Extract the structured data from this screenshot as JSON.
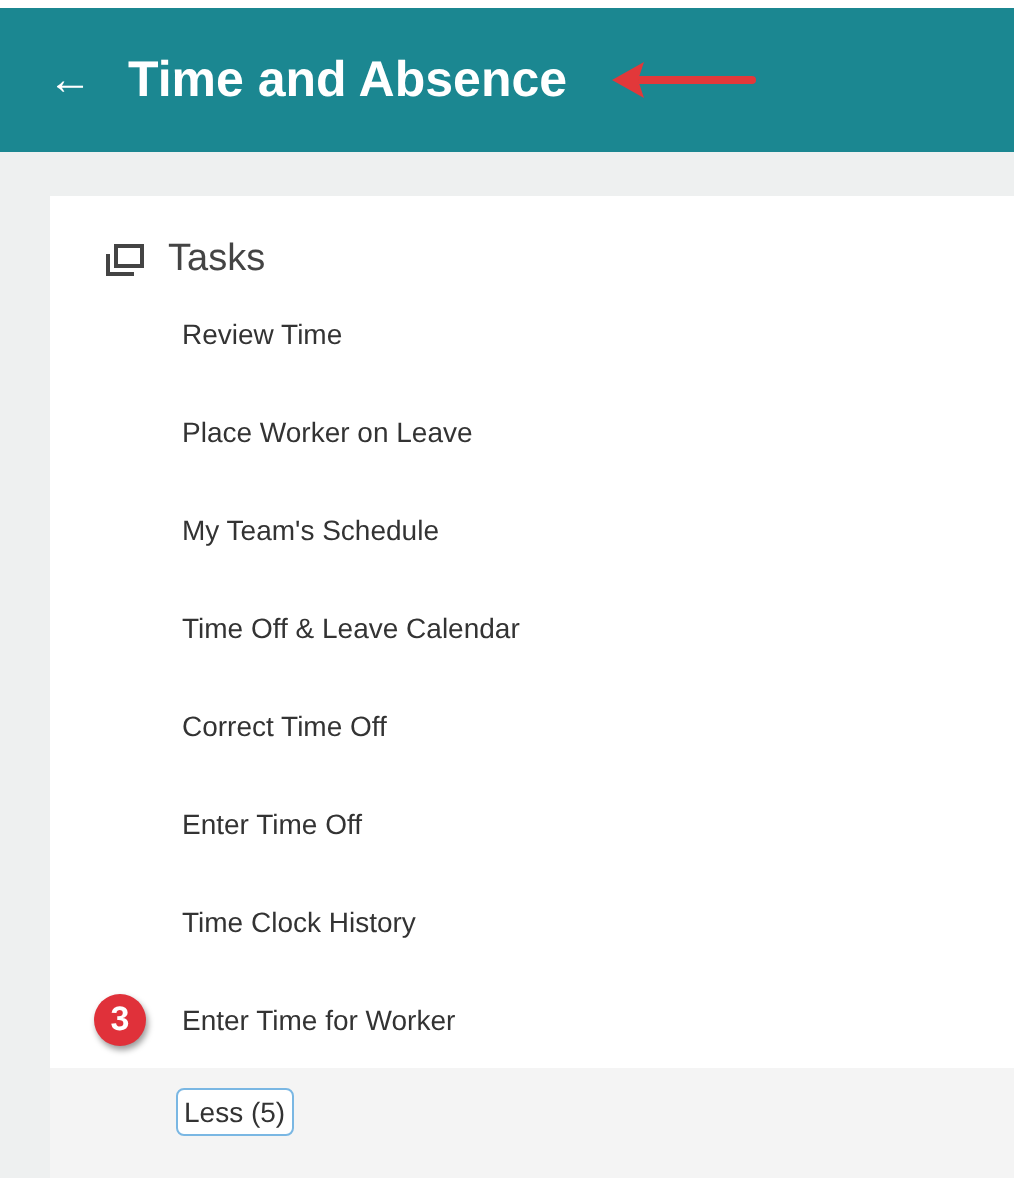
{
  "header": {
    "back": "←",
    "title": "Time and Absence"
  },
  "tasks": {
    "title": "Tasks",
    "items": [
      {
        "label": "Review Time"
      },
      {
        "label": "Place Worker on Leave"
      },
      {
        "label": "My Team's Schedule"
      },
      {
        "label": "Time Off & Leave Calendar"
      },
      {
        "label": "Correct Time Off"
      },
      {
        "label": "Enter Time Off"
      },
      {
        "label": "Time Clock History"
      },
      {
        "label": "Enter Time for Worker",
        "badge": "3"
      }
    ],
    "less_button": "Less (5)"
  }
}
